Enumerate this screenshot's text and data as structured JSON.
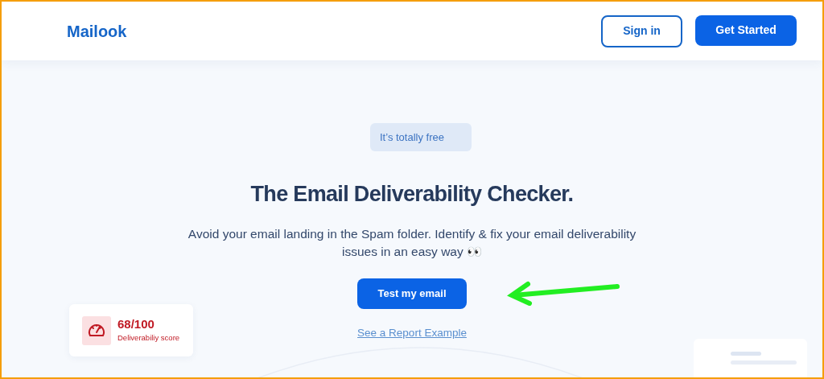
{
  "header": {
    "logo": "Mailook",
    "sign_in": "Sign in",
    "get_started": "Get Started"
  },
  "hero": {
    "badge": "It’s totally free",
    "title": "The Email Deliverability Checker.",
    "subtitle": "Avoid your email landing in the Spam folder. Identify & fix your email deliverability issues in an easy way 👀",
    "button": "Test my email",
    "link": "See a Report Example"
  },
  "score_card": {
    "score": "68/100",
    "label": "Deliverabiliy score"
  }
}
